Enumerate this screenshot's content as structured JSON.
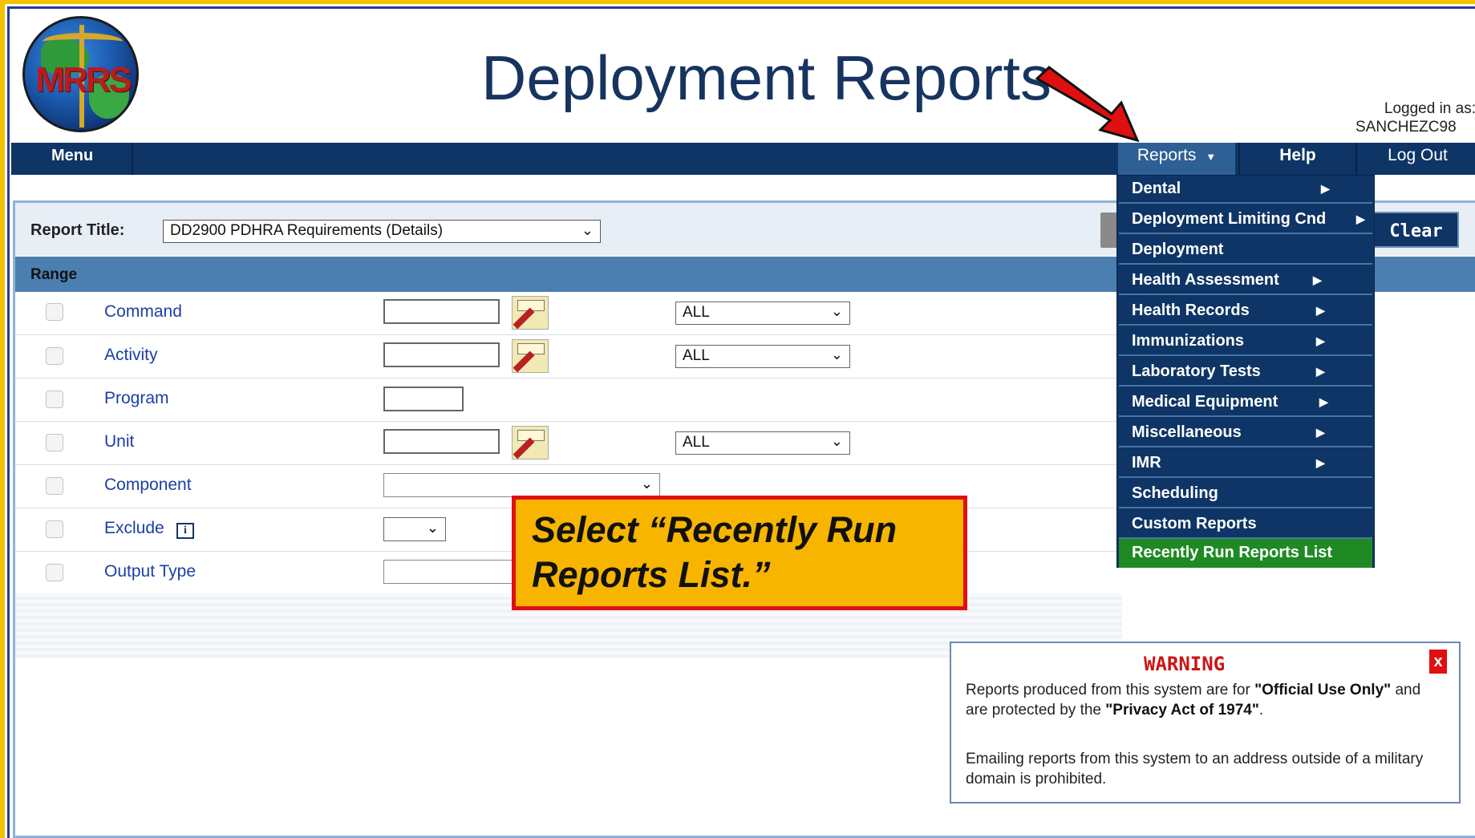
{
  "header": {
    "title": "Deployment Reports",
    "logo_text": "MRRS",
    "logged_in_label": "Logged in as:",
    "logged_in_user": "SANCHEZC98"
  },
  "nav": {
    "menu": "Menu",
    "reports": "Reports",
    "help": "Help",
    "logout": "Log Out"
  },
  "form": {
    "report_title_label": "Report Title:",
    "report_title_value": "DD2900 PDHRA Requirements (Details)",
    "clear_label": "Clear",
    "range_label": "Range",
    "rows": [
      {
        "label": "Command",
        "select": "ALL"
      },
      {
        "label": "Activity",
        "select": "ALL"
      },
      {
        "label": "Program"
      },
      {
        "label": "Unit",
        "select": "ALL"
      },
      {
        "label": "Component"
      },
      {
        "label": "Exclude"
      },
      {
        "label": "Output Type"
      }
    ]
  },
  "reports_menu": [
    {
      "label": "Dental",
      "submenu": true
    },
    {
      "label": "Deployment Limiting Cnd",
      "submenu": true
    },
    {
      "label": "Deployment",
      "submenu": false
    },
    {
      "label": "Health Assessment",
      "submenu": true
    },
    {
      "label": "Health Records",
      "submenu": true
    },
    {
      "label": "Immunizations",
      "submenu": true
    },
    {
      "label": "Laboratory Tests",
      "submenu": true
    },
    {
      "label": "Medical Equipment",
      "submenu": true
    },
    {
      "label": "Miscellaneous",
      "submenu": true
    },
    {
      "label": "IMR",
      "submenu": true
    },
    {
      "label": "Scheduling",
      "submenu": false
    },
    {
      "label": "Custom Reports",
      "submenu": false
    },
    {
      "label": "Recently Run Reports List",
      "submenu": false,
      "highlighted": true
    }
  ],
  "callout": {
    "text": "Select “Recently Run Reports List.”"
  },
  "warning": {
    "title": "WARNING",
    "close": "x",
    "p1_a": "Reports produced from this system are for ",
    "p1_b": "\"Official Use Only\"",
    "p1_c": " and are protected by the ",
    "p1_d": "\"Privacy Act of 1974\"",
    "p1_e": ".",
    "p2": "Emailing reports from this system to an address outside of a military domain is prohibited."
  },
  "colors": {
    "navy": "#0e3566",
    "highlight_green": "#1f8a24",
    "callout_fill": "#f8b500",
    "callout_border": "#e01010",
    "link_blue": "#1a3fa8"
  }
}
